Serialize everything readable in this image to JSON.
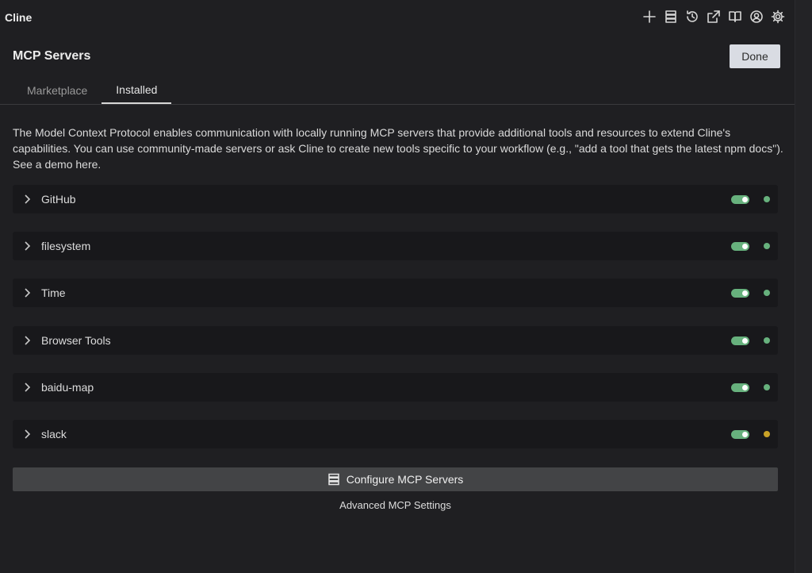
{
  "app": {
    "title": "Cline"
  },
  "toolbar": {
    "icons": [
      "plus-icon",
      "server-stack-icon",
      "history-icon",
      "popout-icon",
      "book-icon",
      "account-icon",
      "settings-icon"
    ]
  },
  "header": {
    "title": "MCP Servers",
    "done_label": "Done"
  },
  "tabs": [
    {
      "label": "Marketplace",
      "active": false
    },
    {
      "label": "Installed",
      "active": true
    }
  ],
  "description": "The Model Context Protocol enables communication with locally running MCP servers that provide additional tools and resources to extend Cline's capabilities. You can use community-made servers or ask Cline to create new tools specific to your workflow (e.g., \"add a tool that gets the latest npm docs\"). See a demo here.",
  "servers": [
    {
      "name": "GitHub",
      "enabled": true,
      "status_color": "#67b17d"
    },
    {
      "name": "filesystem",
      "enabled": true,
      "status_color": "#67b17d"
    },
    {
      "name": "Time",
      "enabled": true,
      "status_color": "#67b17d"
    },
    {
      "name": "Browser Tools",
      "enabled": true,
      "status_color": "#67b17d"
    },
    {
      "name": "baidu-map",
      "enabled": true,
      "status_color": "#67b17d"
    },
    {
      "name": "slack",
      "enabled": true,
      "status_color": "#c9a227"
    }
  ],
  "footer": {
    "configure_label": "Configure MCP Servers",
    "advanced_label": "Advanced MCP Settings"
  },
  "colors": {
    "background": "#1f1f22",
    "row_background": "#18181b",
    "toggle_on": "#67b17d",
    "status_ok": "#67b17d",
    "status_warn": "#c9a227",
    "button_secondary": "#434446"
  }
}
